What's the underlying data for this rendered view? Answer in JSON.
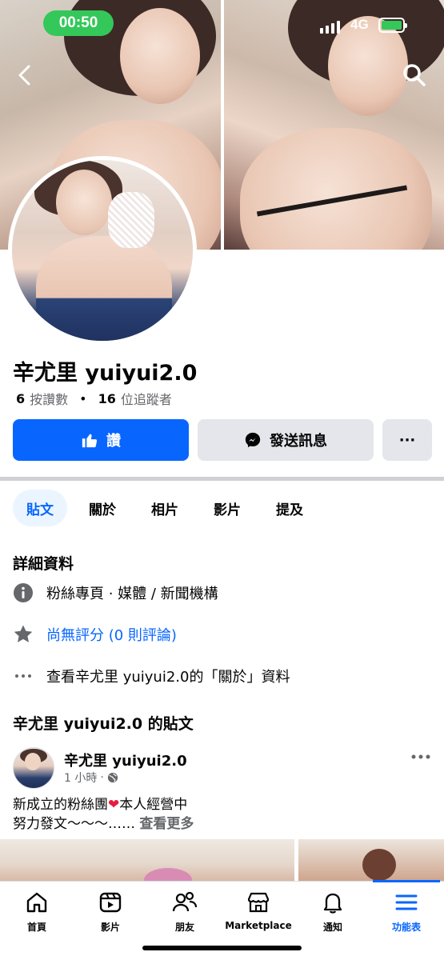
{
  "status_bar": {
    "time": "00:50",
    "network": "4G",
    "battery_color": "#34c759"
  },
  "header": {
    "back_icon": "chevron-left-icon",
    "search_icon": "search-icon"
  },
  "profile": {
    "name": "辛尤里 yuiyui2.0",
    "likes_count": "6",
    "likes_label": "按讚數",
    "followers_count": "16",
    "followers_label": "位追蹤者"
  },
  "actions": {
    "like_label": "讚",
    "message_label": "發送訊息",
    "more_label": "···",
    "like_color": "#0866ff"
  },
  "tabs": [
    {
      "label": "貼文",
      "active": true
    },
    {
      "label": "關於",
      "active": false
    },
    {
      "label": "相片",
      "active": false
    },
    {
      "label": "影片",
      "active": false
    },
    {
      "label": "提及",
      "active": false
    }
  ],
  "details": {
    "title": "詳細資料",
    "category": "粉絲專頁 · 媒體 / 新聞機構",
    "rating": "尚無評分 (0 則評論)",
    "about_link": "查看辛尤里 yuiyui2.0的「關於」資料"
  },
  "posts_section": {
    "title": "辛尤里 yuiyui2.0 的貼文"
  },
  "post": {
    "author": "辛尤里 yuiyui2.0",
    "time": "1 小時",
    "text_line1_a": "新成立的粉絲團",
    "text_line1_b": "本人經營中",
    "text_line2": "努力發文～～～……",
    "see_more": "查看更多"
  },
  "bottom_nav": [
    {
      "label": "首頁",
      "icon": "home-icon"
    },
    {
      "label": "影片",
      "icon": "video-icon"
    },
    {
      "label": "朋友",
      "icon": "friends-icon"
    },
    {
      "label": "Marketplace",
      "icon": "marketplace-icon"
    },
    {
      "label": "通知",
      "icon": "bell-icon"
    },
    {
      "label": "功能表",
      "icon": "menu-icon",
      "active": true
    }
  ]
}
